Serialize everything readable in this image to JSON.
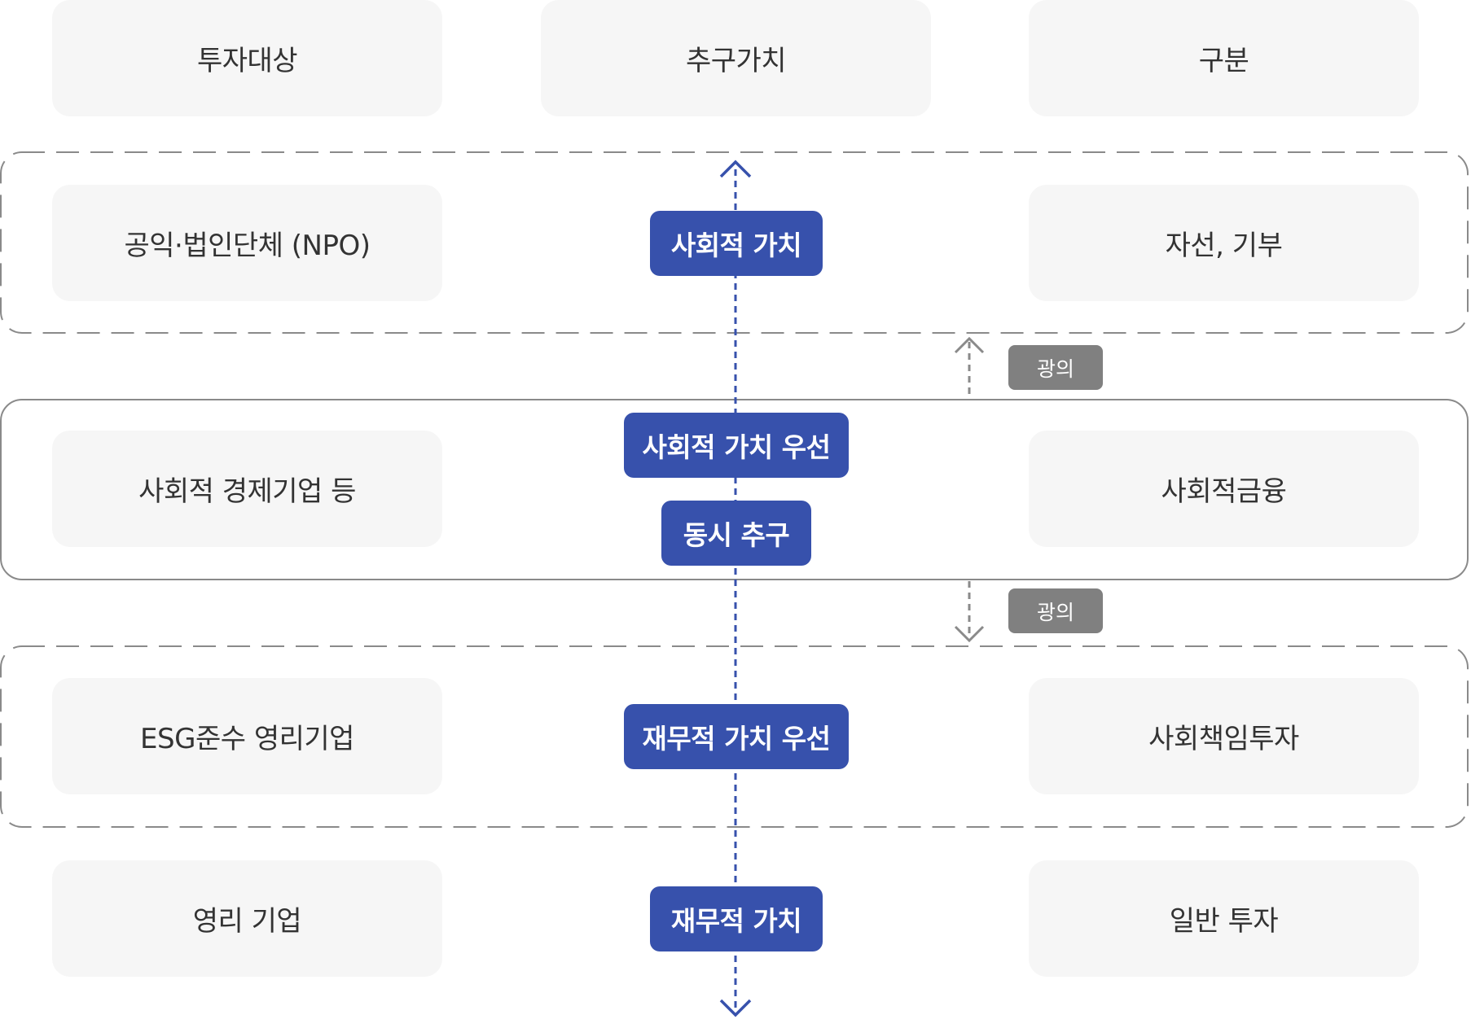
{
  "header": {
    "col1": "투자대상",
    "col2": "추구가치",
    "col3": "구분"
  },
  "rows": [
    {
      "target": "공익·법인단체 (NPO)",
      "value": "사회적 가치",
      "category": "자선, 기부"
    },
    {
      "target": "사회적 경제기업 등",
      "value_top": "사회적 가치 우선",
      "value_bottom": "동시 추구",
      "category": "사회적금융"
    },
    {
      "target": "ESG준수 영리기업",
      "value": "재무적 가치 우선",
      "category": "사회책임투자"
    },
    {
      "target": "영리 기업",
      "value": "재무적 가치",
      "category": "일반 투자"
    }
  ],
  "side_tags": {
    "upper": "광의",
    "lower": "광의"
  },
  "colors": {
    "accent": "#3751ac",
    "tag": "#808080",
    "box": "#f6f6f6",
    "border": "#8a8a8a"
  },
  "icons": [
    "arrow-up-icon",
    "arrow-down-icon",
    "dashed-arrow-up-icon",
    "dashed-arrow-down-icon"
  ]
}
